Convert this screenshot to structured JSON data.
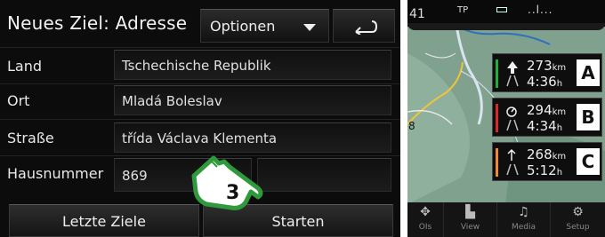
{
  "header": {
    "title": "Neues Ziel: Adresse",
    "options_label": "Optionen",
    "back_icon": "return-arrow-icon"
  },
  "form": {
    "rows": [
      {
        "label": "Land",
        "value": "Tschechische Republik"
      },
      {
        "label": "Ort",
        "value": "Mladá Boleslav"
      },
      {
        "label": "Straße",
        "value": "třída Václava Klementa"
      },
      {
        "label": "Hausnummer",
        "value": "869"
      }
    ]
  },
  "footer": {
    "recent_label": "Letzte Ziele",
    "start_label": "Starten"
  },
  "overlay": {
    "step_number": "3",
    "icon": "pointing-hand-icon"
  },
  "map": {
    "status": {
      "road_number": "41",
      "tp": "TP",
      "signal": "..l..."
    },
    "routes": [
      {
        "distance": "273",
        "distance_unit": "km",
        "time": "4:36",
        "time_unit": "h",
        "letter": "A",
        "color": "#1fae3c",
        "icon": "fast-route-icon"
      },
      {
        "distance": "294",
        "distance_unit": "km",
        "time": "4:34",
        "time_unit": "h",
        "letter": "B",
        "color": "#d7282c",
        "icon": "economic-route-icon"
      },
      {
        "distance": "268",
        "distance_unit": "km",
        "time": "5:12",
        "time_unit": "h",
        "letter": "C",
        "color": "#f08a2a",
        "icon": "short-route-icon"
      }
    ],
    "nav": [
      {
        "label": "OIs",
        "icon": "poi-icon"
      },
      {
        "label": "View",
        "icon": "car-view-icon"
      },
      {
        "label": "Media",
        "icon": "music-note-icon"
      },
      {
        "label": "Setup",
        "icon": "gear-icon"
      }
    ]
  }
}
